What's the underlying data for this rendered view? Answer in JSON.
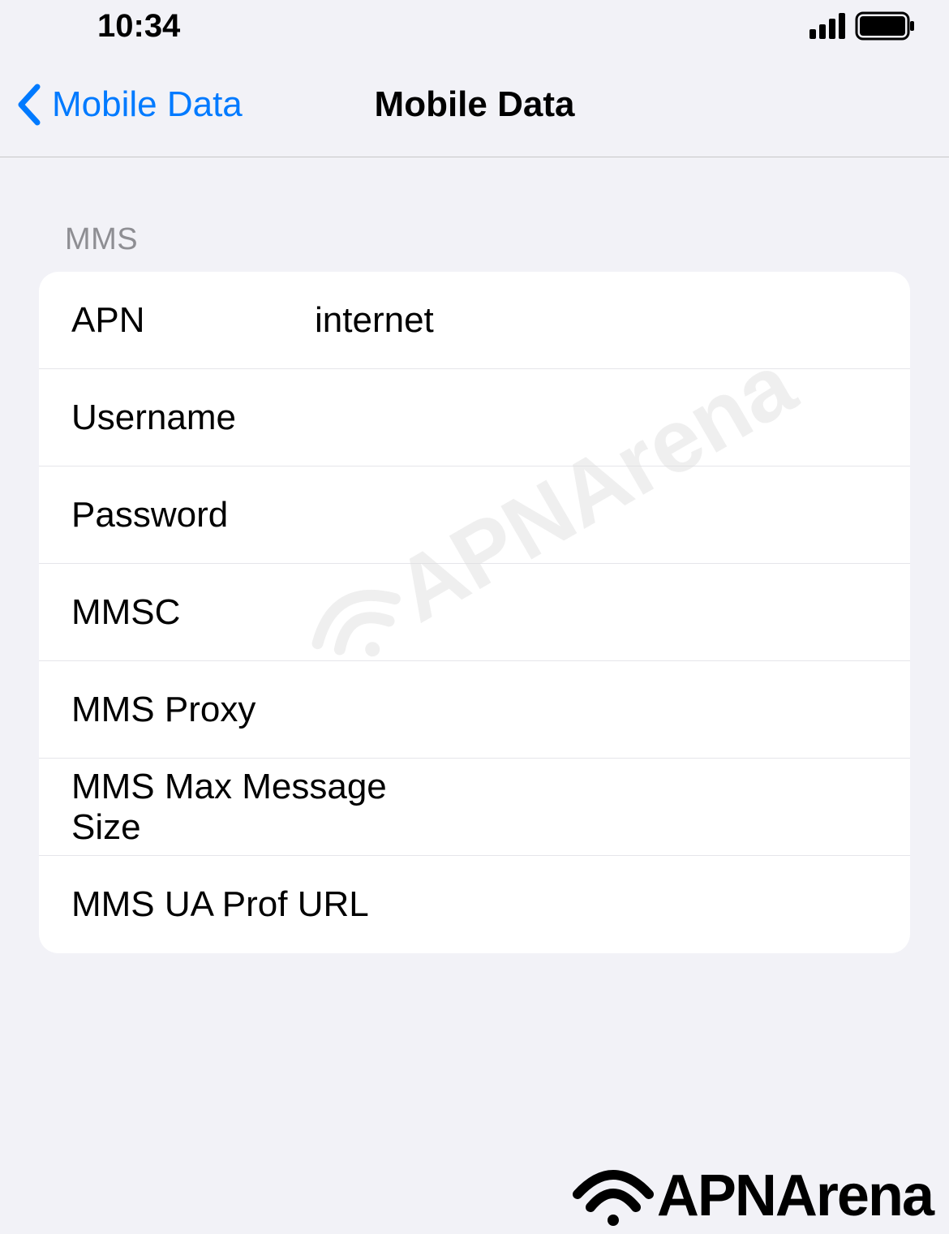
{
  "status_bar": {
    "time": "10:34"
  },
  "nav": {
    "back_label": "Mobile Data",
    "title": "Mobile Data"
  },
  "section": {
    "header": "MMS",
    "rows": [
      {
        "label": "APN",
        "value": "internet"
      },
      {
        "label": "Username",
        "value": ""
      },
      {
        "label": "Password",
        "value": ""
      },
      {
        "label": "MMSC",
        "value": ""
      },
      {
        "label": "MMS Proxy",
        "value": ""
      },
      {
        "label": "MMS Max Message Size",
        "value": ""
      },
      {
        "label": "MMS UA Prof URL",
        "value": ""
      }
    ]
  },
  "watermark": {
    "text": "APNArena"
  },
  "footer_watermark": {
    "text": "APNArena"
  }
}
